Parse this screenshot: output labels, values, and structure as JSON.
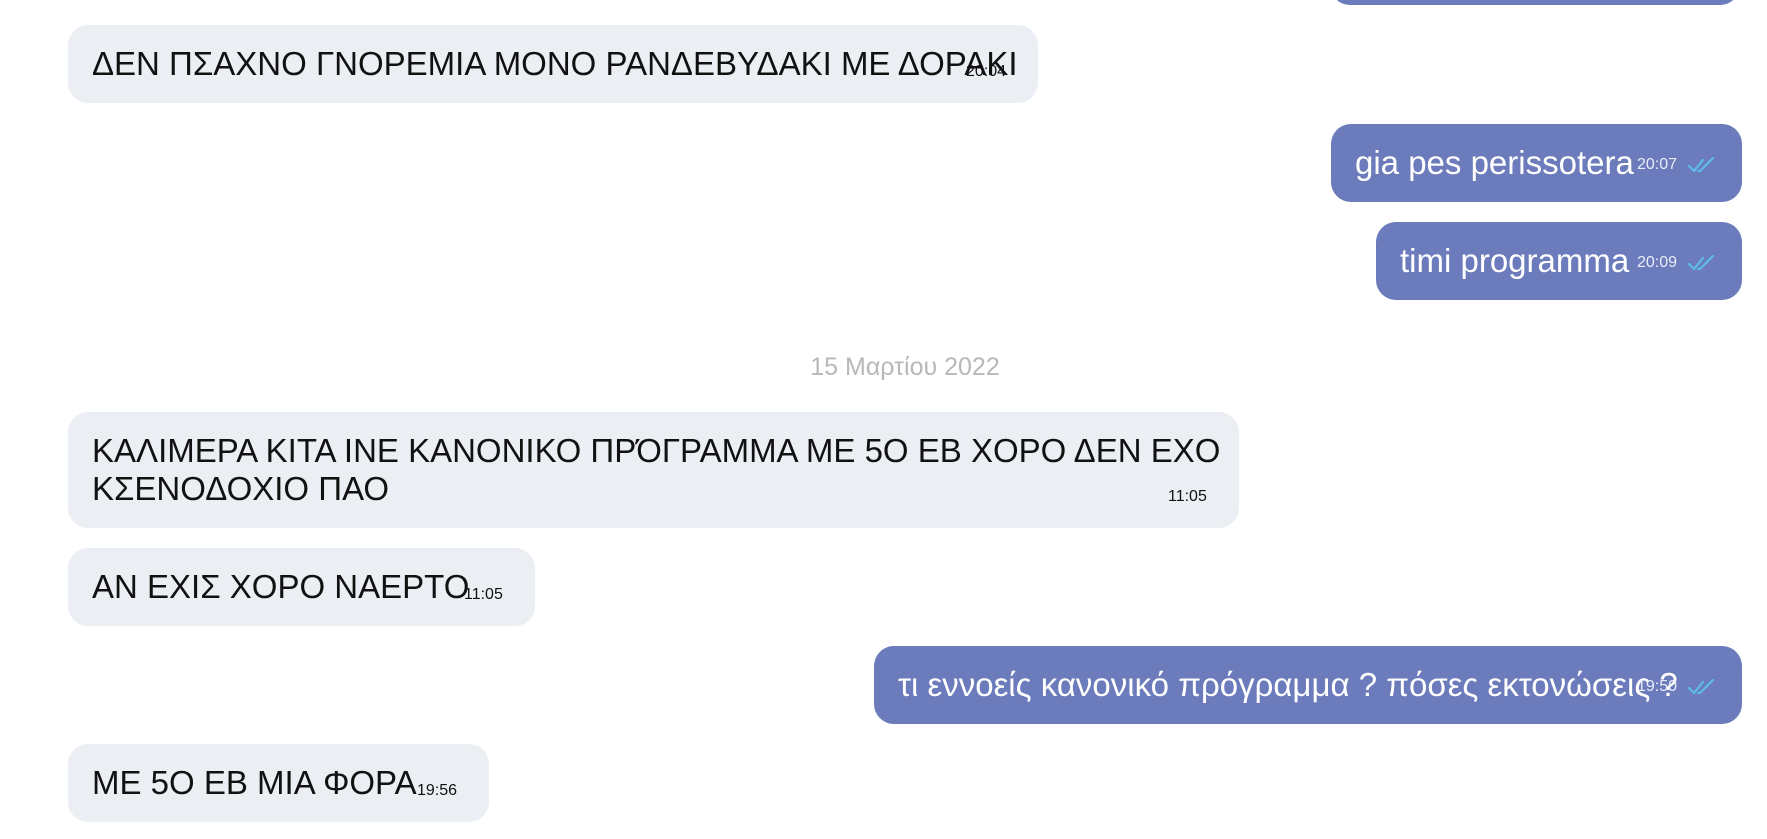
{
  "messages": [
    {
      "direction": "out",
      "text": "",
      "time": ""
    },
    {
      "direction": "in",
      "text": "ΔΕΝ ΠΣΑΧΝΟ ΓΝΟΡΕΜΙΑ ΜΟΝΟ ΡΑΝΔΕΒΥΔΑΚΙ ΜΕ ΔΟΡΑΚΙ",
      "time": "20:04"
    },
    {
      "direction": "out",
      "text": "gia pes perissotera",
      "time": "20:07",
      "status": "read"
    },
    {
      "direction": "out",
      "text": "timi programma",
      "time": "20:09",
      "status": "read"
    },
    {
      "direction": "in",
      "text_line1": "ΚΑΛΙΜΕΡΑ ΚΙΤΑ ΙΝΕ ΚΑΝΟΝΙΚΟ ΠΡΌΓΡΑΜΜΑ ΜΕ 5Ο ΕΒ ΧΟΡΟ ΔΕΝ ΕΧΟ",
      "text_line2": "ΚΣΕΝΟΔΟΧΙΟ ΠΑΟ",
      "time": "11:05"
    },
    {
      "direction": "in",
      "text": "ΑΝ ΕΧΙΣ ΧΟΡΟ ΝΑΕΡΤΟ",
      "time": "11:05"
    },
    {
      "direction": "out",
      "text": "τι εννοείς κανονικό πρόγραμμα ? πόσες εκτονώσεις ?",
      "time": "19:50",
      "status": "read"
    },
    {
      "direction": "in",
      "text": "ΜΕ 5Ο ΕΒ ΜΙΑ ΦΟΡΑ",
      "time": "19:56"
    }
  ],
  "date_separator": "15 Μαρτίου 2022",
  "colors": {
    "incoming_bubble": "#ebeef3",
    "outgoing_bubble": "#6b7bbb",
    "read_check": "#5fb9ea",
    "date_text": "#b8b8b8"
  },
  "icons": {
    "read_status": "double-check-icon"
  }
}
